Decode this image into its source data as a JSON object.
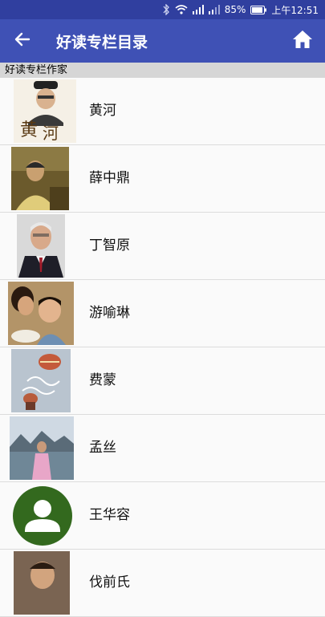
{
  "status_bar": {
    "battery": "85%",
    "time": "上午12:51"
  },
  "app_bar": {
    "title": "好读专栏目录",
    "back_icon": "arrow-back-icon",
    "home_icon": "home-icon"
  },
  "section": {
    "header": "好读专栏作家"
  },
  "authors": [
    {
      "name": "黄河"
    },
    {
      "name": "薛中鼎"
    },
    {
      "name": "丁智原"
    },
    {
      "name": "游喻琳"
    },
    {
      "name": "费蒙"
    },
    {
      "name": "孟丝"
    },
    {
      "name": "王华容"
    },
    {
      "name": "伐前氏"
    }
  ],
  "colors": {
    "primary": "#3f51b5",
    "primary_dark": "#303f9f",
    "avatar_green": "#33691e"
  }
}
